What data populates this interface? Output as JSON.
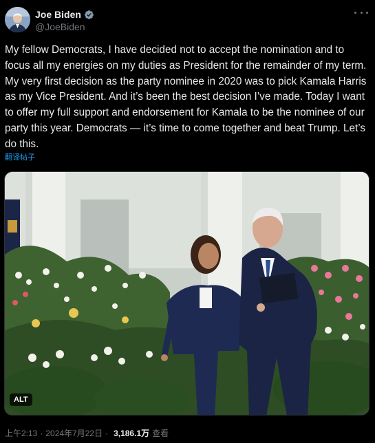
{
  "author": {
    "name": "Joe Biden",
    "handle": "@JoeBiden"
  },
  "post": {
    "text": "My fellow Democrats, I have decided not to accept the nomination and to focus all my energies on my duties as President for the remainder of my term. My very first decision as the party nominee in 2020 was to pick Kamala Harris as my Vice President. And it’s been the best decision I’ve made. Today I want to offer my full support and endorsement for Kamala to be the nominee of our party this year. Democrats — it’s time to come together and beat Trump. Let’s do this.",
    "translate_label": "翻译帖子",
    "media_alt_badge": "ALT"
  },
  "meta": {
    "time": "上午2:13",
    "separator": "·",
    "date": "2024年7月22日",
    "views_count": "3,186.1万",
    "views_label": "查看"
  },
  "colors": {
    "background": "#000000",
    "text_primary": "#e7e9ea",
    "text_secondary": "#71767b",
    "accent": "#1d9bf0"
  },
  "icons": {
    "verified": "verified-badge-icon",
    "more": "more-options-icon"
  }
}
